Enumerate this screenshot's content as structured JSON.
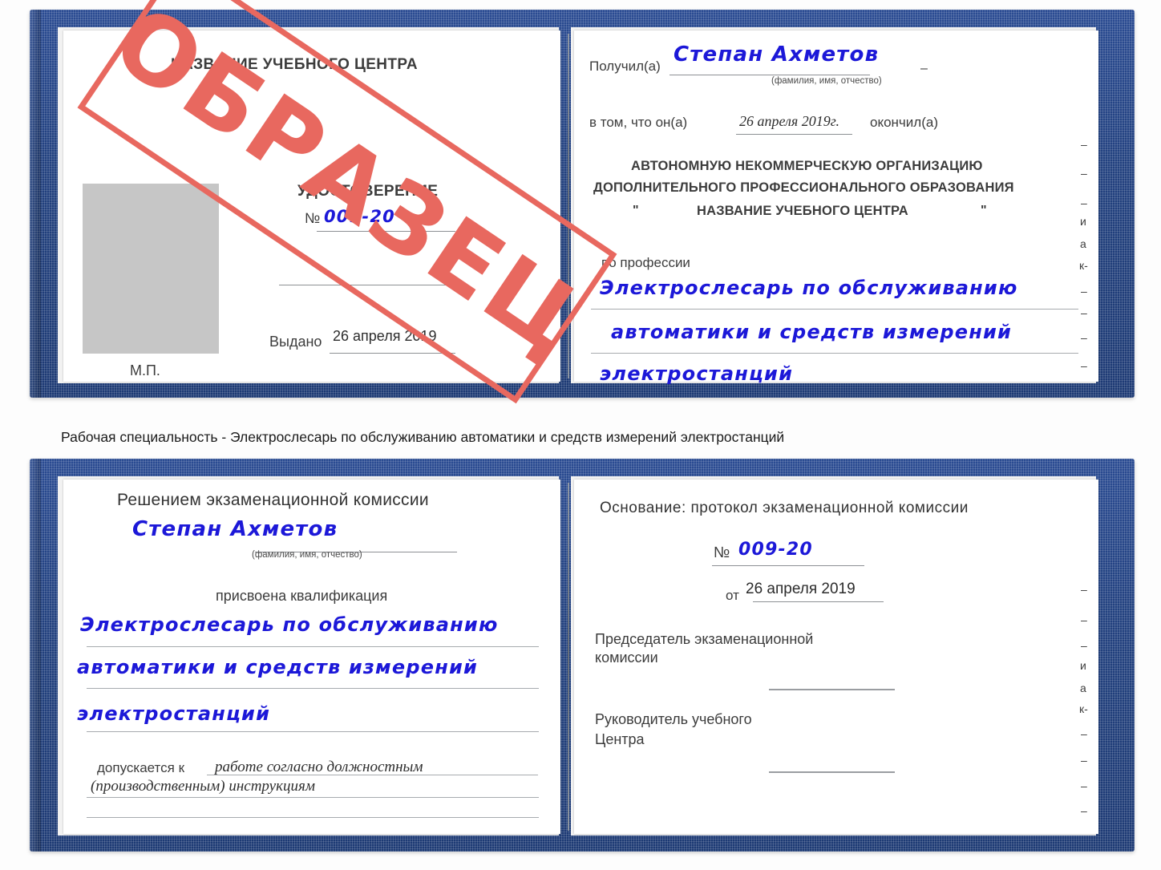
{
  "document": {
    "type": "certificate-scan",
    "colors": {
      "cover_blue": "#22417f",
      "stamp_red": "#e8685f",
      "ink_blue": "#1c18d8",
      "print_gray": "#3c3c3c",
      "photo_placeholder": "#c6c6c6"
    }
  },
  "certificate_top": {
    "left_page": {
      "center_name_header": "НАЗВАНИЕ УЧЕБНОГО ЦЕНТРА",
      "doc_title": "УДОСТОВЕРЕНИЕ",
      "number_label": "№",
      "number_value": "009-20",
      "issued_label": "Выдано",
      "issued_value": "26 апреля 2019",
      "stamp_place_label": "М.П."
    },
    "right_page": {
      "received_label": "Получил(а)",
      "received_value": "Степан Ахметов",
      "received_hint": "(фамилия, имя, отчество)",
      "in_that_label": "в том, что он(а)",
      "completion_date": "26 апреля 2019г.",
      "finished_label": "окончил(а)",
      "org_line1": "АВТОНОМНУЮ НЕКОММЕРЧЕСКУЮ ОРГАНИЗАЦИЮ",
      "org_line2": "ДОПОЛНИТЕЛЬНОГО ПРОФЕССИОНАЛЬНОГО ОБРАЗОВАНИЯ",
      "org_quote_open": "\"",
      "org_line3": "НАЗВАНИЕ УЧЕБНОГО ЦЕНТРА",
      "org_quote_close": "\"",
      "profession_label": "по профессии",
      "profession_line1": "Электрослесарь по обслуживанию",
      "profession_line2": "автоматики и средств измерений",
      "profession_line3": "электростанций",
      "edge_fragments": [
        "–",
        "–",
        "–",
        "и",
        "а",
        "к-",
        "–",
        "–",
        "–",
        "–"
      ]
    }
  },
  "stamp": {
    "text": "ОБРАЗЕЦ"
  },
  "caption": {
    "text": "Рабочая специальность - Электрослесарь по обслуживанию автоматики и средств измерений электростанций"
  },
  "certificate_bottom": {
    "left_page": {
      "heading": "Решением экзаменационной комиссии",
      "name_value": "Степан Ахметов",
      "name_hint": "(фамилия, имя, отчество)",
      "qualification_label": "присвоена квалификация",
      "qualification_line1": "Электрослесарь по обслуживанию",
      "qualification_line2": "автоматики и средств измерений",
      "qualification_line3": "электростанций",
      "admitted_label": "допускается к",
      "admitted_value_line1": "работе согласно должностным",
      "admitted_value_line2": "(производственным) инструкциям"
    },
    "right_page": {
      "basis_label": "Основание: протокол экзаменационной комиссии",
      "number_label": "№",
      "number_value": "009-20",
      "date_label": "от",
      "date_value": "26 апреля 2019",
      "chairman_line1": "Председатель экзаменационной",
      "chairman_line2": "комиссии",
      "head_line1": "Руководитель учебного",
      "head_line2": "Центра",
      "edge_fragments": [
        "–",
        "–",
        "–",
        "и",
        "а",
        "к-",
        "–",
        "–",
        "–",
        "–"
      ]
    }
  }
}
